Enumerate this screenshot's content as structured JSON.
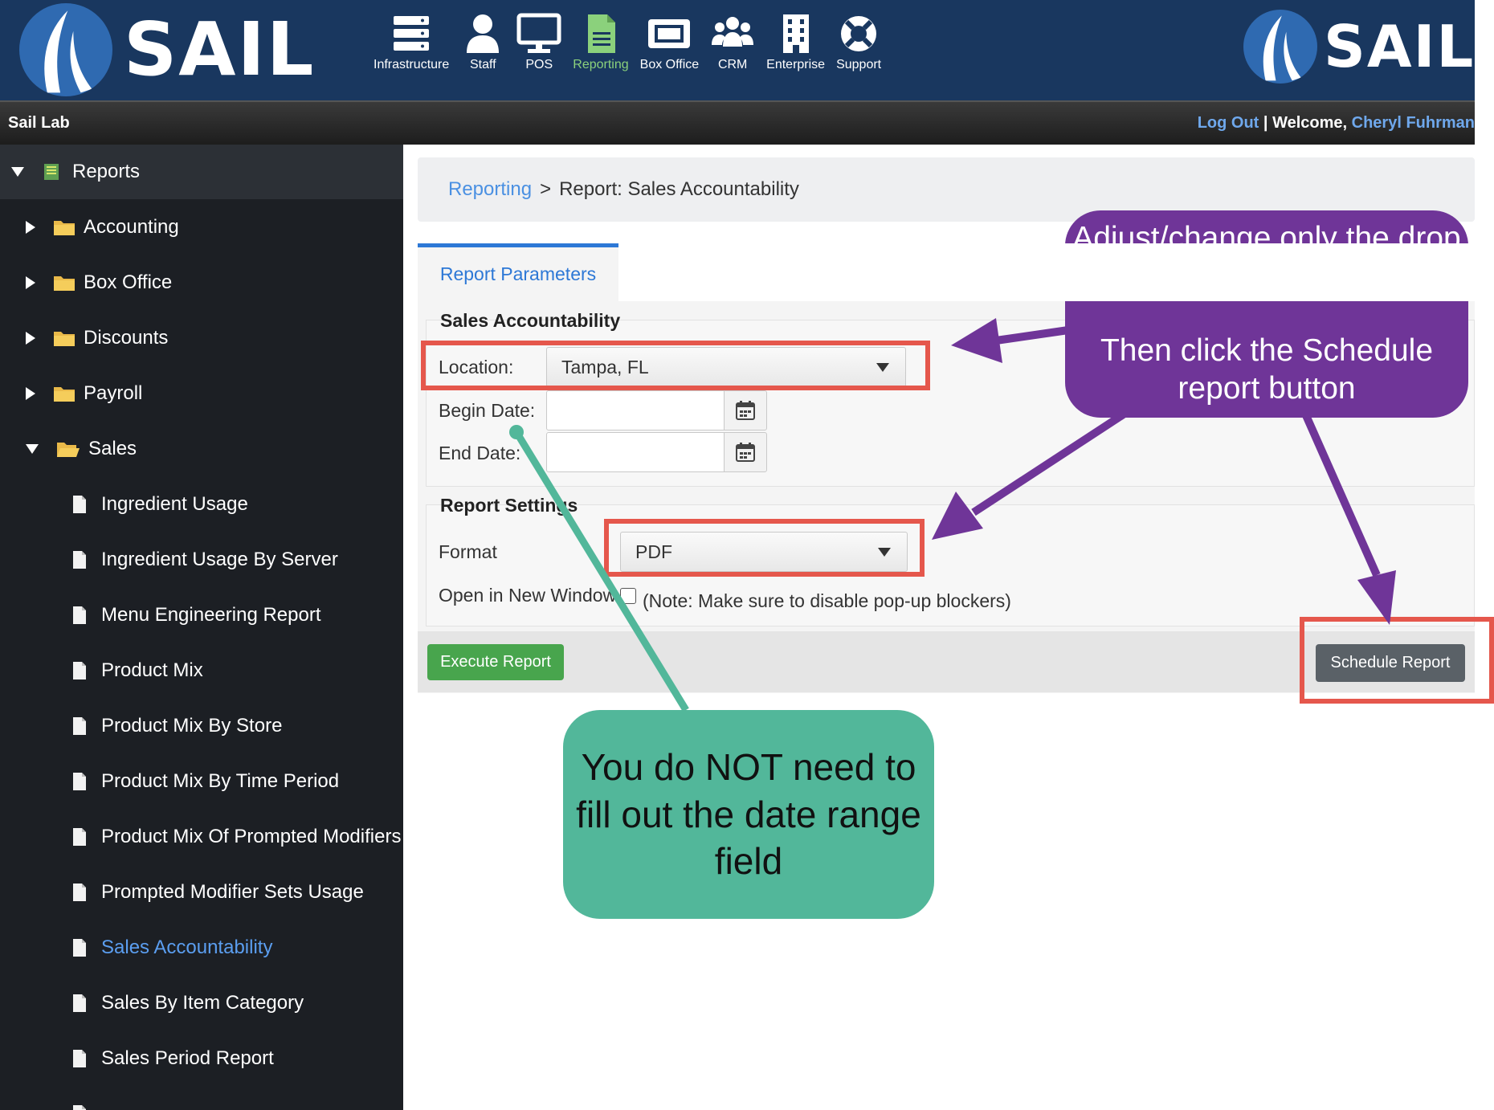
{
  "brand": {
    "logo_text": "SAIL",
    "logo_text_right": "SAIL"
  },
  "colors": {
    "topbar": "#19375f",
    "accent_blue": "#2d78d6",
    "active_nav": "#8bd17c",
    "annotation_red": "#e5574c",
    "annotation_purple": "#6f3598",
    "annotation_green": "#52b79a"
  },
  "nav": [
    {
      "label": "Infrastructure",
      "icon": "server-icon"
    },
    {
      "label": "Staff",
      "icon": "person-icon"
    },
    {
      "label": "POS",
      "icon": "monitor-icon"
    },
    {
      "label": "Reporting",
      "icon": "document-icon",
      "active": true
    },
    {
      "label": "Box Office",
      "icon": "ticket-icon"
    },
    {
      "label": "CRM",
      "icon": "group-icon"
    },
    {
      "label": "Enterprise",
      "icon": "building-icon"
    },
    {
      "label": "Support",
      "icon": "lifebuoy-icon"
    }
  ],
  "subbar": {
    "lab_name": "Sail Lab",
    "logout": "Log Out",
    "separator": "|",
    "welcome": "Welcome,",
    "user": "Cheryl Fuhrman"
  },
  "sidebar": {
    "root": "Reports",
    "folders": [
      {
        "label": "Accounting"
      },
      {
        "label": "Box Office"
      },
      {
        "label": "Discounts"
      },
      {
        "label": "Payroll"
      },
      {
        "label": "Sales"
      }
    ],
    "reports": [
      {
        "label": "Ingredient Usage"
      },
      {
        "label": "Ingredient Usage By Server"
      },
      {
        "label": "Menu Engineering Report"
      },
      {
        "label": "Product Mix"
      },
      {
        "label": "Product Mix By Store"
      },
      {
        "label": "Product Mix By Time Period"
      },
      {
        "label": "Product Mix Of Prompted Modifiers"
      },
      {
        "label": "Prompted Modifier Sets Usage"
      },
      {
        "label": "Sales Accountability",
        "active": true
      },
      {
        "label": "Sales By Item Category"
      },
      {
        "label": "Sales Period Report"
      }
    ]
  },
  "breadcrumb": {
    "link": "Reporting",
    "separator": ">",
    "current": "Report: Sales Accountability"
  },
  "tab": {
    "label": "Report Parameters"
  },
  "form": {
    "section1_title": "Sales Accountability",
    "location_label": "Location:",
    "location_value": "Tampa, FL",
    "begin_label": "Begin Date:",
    "begin_value": "",
    "end_label": "End Date:",
    "end_value": "",
    "section2_title": "Report Settings",
    "format_label": "Format",
    "format_value": "PDF",
    "new_window_label": "Open in New Window",
    "new_window_checked": false,
    "note": "(Note: Make sure to disable pop-up blockers)"
  },
  "buttons": {
    "execute": "Execute Report",
    "schedule": "Schedule Report"
  },
  "annotations": {
    "purple_line1": "Adjust/change only the drop downs",
    "purple_line2": "Then click the Schedule report button",
    "green": "You do NOT need to fill out the date range field"
  }
}
